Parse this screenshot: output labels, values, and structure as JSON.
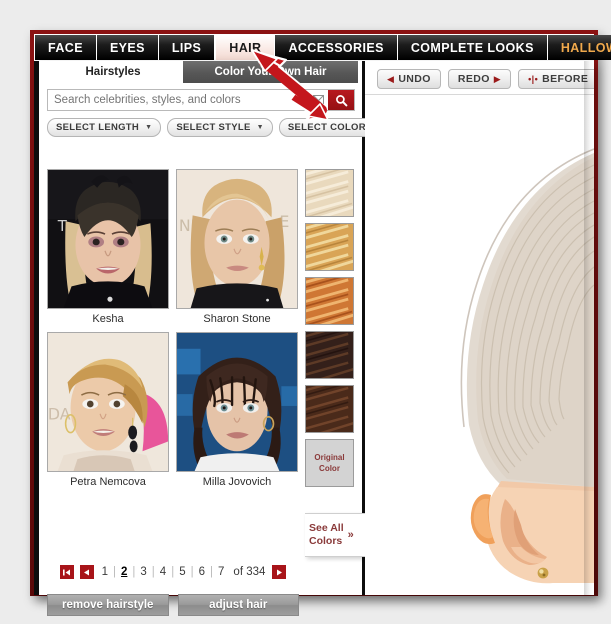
{
  "app": {
    "frame_color": "#7a0e0e",
    "tabbar": {
      "tabs": [
        {
          "label": "FACE",
          "active": false
        },
        {
          "label": "EYES",
          "active": false
        },
        {
          "label": "LIPS",
          "active": false
        },
        {
          "label": "HAIR",
          "active": true
        },
        {
          "label": "ACCESSORIES",
          "active": false
        },
        {
          "label": "COMPLETE LOOKS",
          "active": false
        },
        {
          "label": "HALLOWEEN",
          "active": false,
          "accent_color": "#f0a94c"
        }
      ]
    }
  },
  "left_panel": {
    "subtabs": [
      {
        "label": "Hairstyles",
        "active": true
      },
      {
        "label": "Color Your Own Hair",
        "active": false
      }
    ],
    "search": {
      "placeholder": "Search celebrities, styles, and colors",
      "value": "",
      "clear_icon": "close-box-icon",
      "search_icon": "magnifier-icon",
      "button_color": "#a41318"
    },
    "filters": [
      {
        "label": "SELECT LENGTH",
        "caret": "▼"
      },
      {
        "label": "SELECT STYLE",
        "caret": "▼"
      },
      {
        "label": "SELECT COLOR",
        "caret": "▼"
      }
    ],
    "styles": [
      {
        "name": "Kesha"
      },
      {
        "name": "Sharon Stone"
      },
      {
        "name": "Petra Nemcova"
      },
      {
        "name": "Milla Jovovich"
      }
    ],
    "swatches": [
      {
        "name": "light-blonde",
        "color": "#e8d6bb"
      },
      {
        "name": "golden-blonde",
        "color": "#d9a456"
      },
      {
        "name": "copper-red",
        "color": "#c96a2a"
      },
      {
        "name": "dark-brown",
        "color": "#3a2117"
      },
      {
        "name": "medium-brown",
        "color": "#4e2b1a"
      },
      {
        "name": "original-color",
        "label": "Original\nColor",
        "label_line1": "Original",
        "label_line2": "Color",
        "color": "#d3d3d3"
      }
    ],
    "see_all": {
      "line1": "See All",
      "line2": "Colors",
      "chevron": "»"
    },
    "pagination": {
      "first": "⏮",
      "prev": "◀",
      "next": "▶",
      "pages": [
        "1",
        "2",
        "3",
        "4",
        "5",
        "6",
        "7"
      ],
      "current": "2",
      "of_label": "of 334",
      "total": 334,
      "separator": "|"
    },
    "actions": [
      {
        "label": "remove hairstyle"
      },
      {
        "label": "adjust hair"
      }
    ]
  },
  "right_panel": {
    "toolbar": [
      {
        "label": "UNDO",
        "icon": "chevron-left-icon",
        "icon_glyph": "◀"
      },
      {
        "label": "REDO",
        "icon": "chevron-right-icon",
        "icon_glyph": "▶"
      },
      {
        "label": "BEFORE",
        "icon": "split-view-icon",
        "icon_glyph": "•|•"
      }
    ],
    "model_photo_alt": "model-hair-preview"
  },
  "annotation": {
    "arrow_color": "#c01a1a",
    "arrow_points_to": "HAIR"
  }
}
